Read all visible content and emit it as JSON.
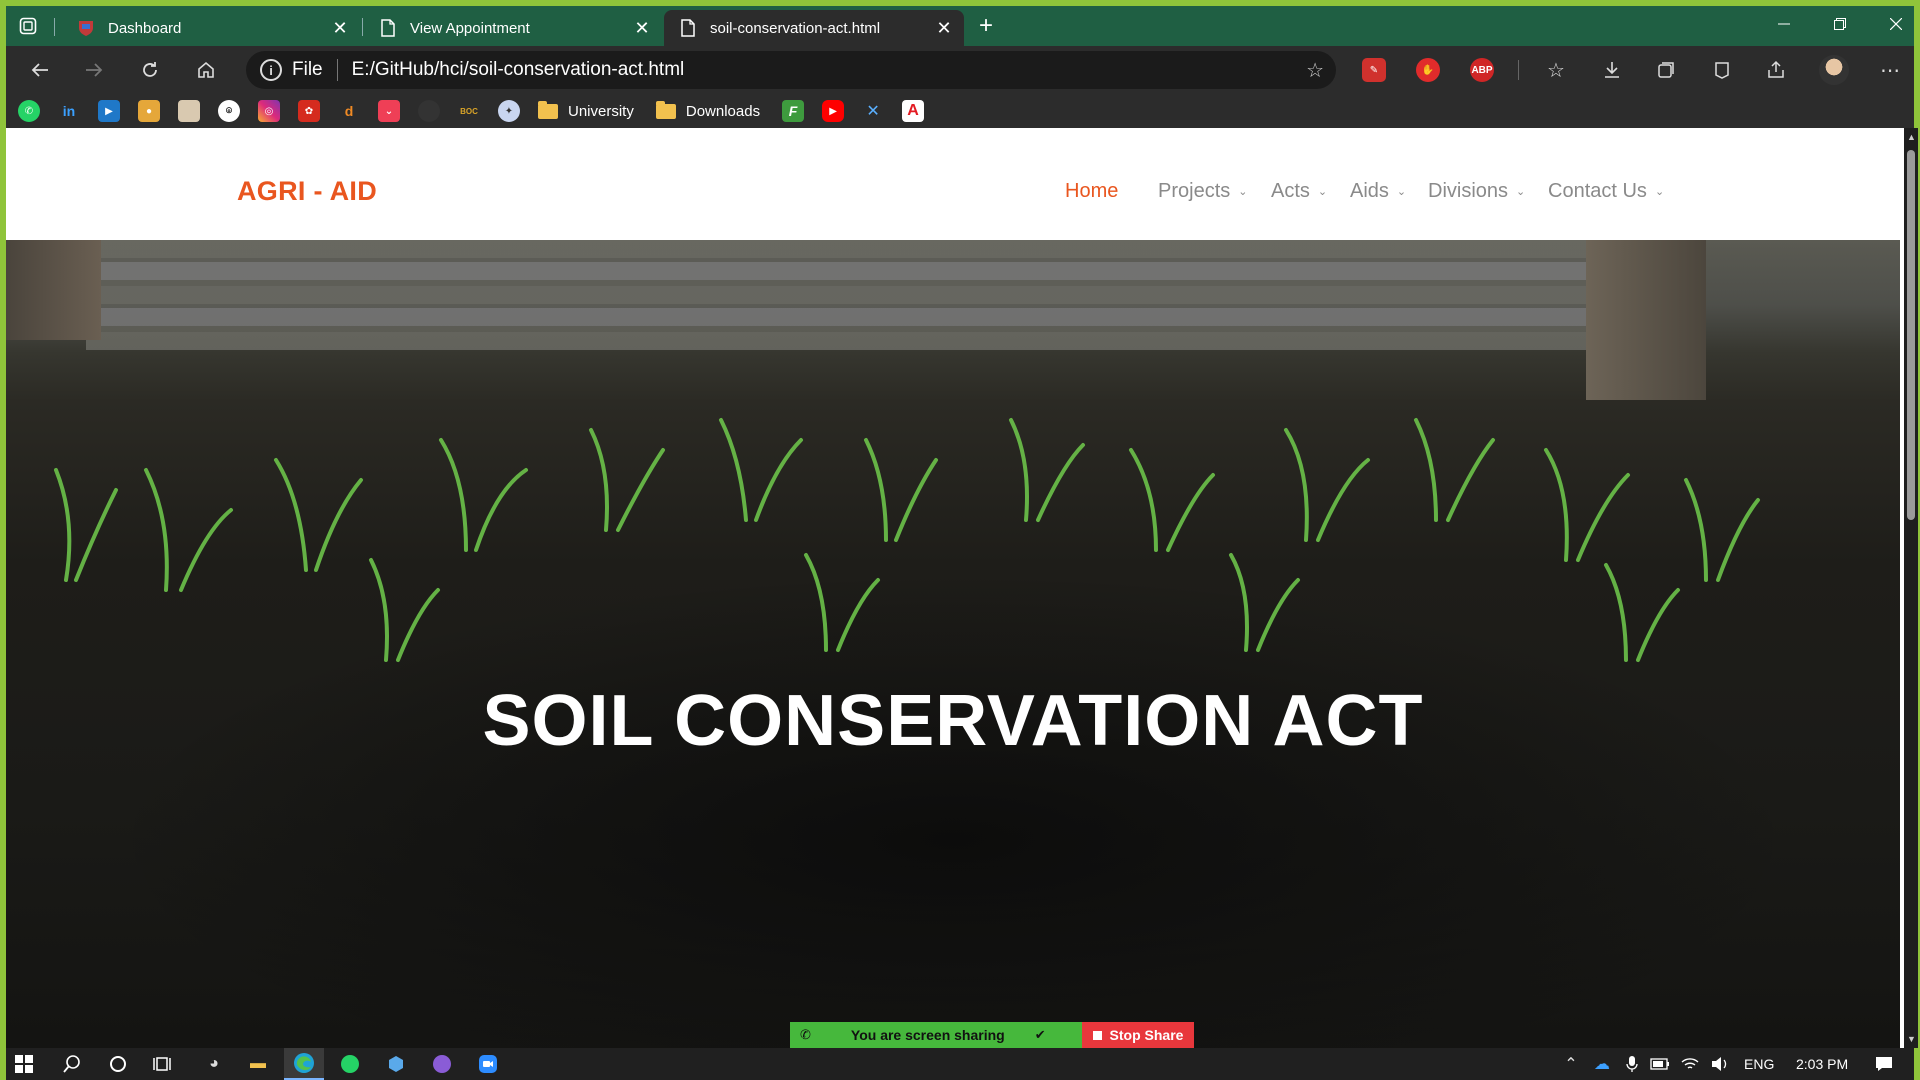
{
  "browser": {
    "tabs": [
      {
        "title": "Dashboard",
        "favicon": "shield-crest-icon",
        "active": false
      },
      {
        "title": "View Appointment",
        "favicon": "document-icon",
        "active": false
      },
      {
        "title": "soil-conservation-act.html",
        "favicon": "document-icon",
        "active": true
      }
    ],
    "close_glyph": "✕",
    "new_tab_glyph": "+",
    "address": {
      "scheme_label": "File",
      "url": "E:/GitHub/hci/soil-conservation-act.html"
    },
    "extensions": [
      "pen-extension-icon",
      "hand-extension-icon",
      "adblock-plus-icon"
    ],
    "extension_labels": {
      "abp": "ABP"
    },
    "bookmarks": {
      "folders": [
        {
          "label": "University"
        },
        {
          "label": "Downloads"
        }
      ],
      "icons": [
        "whatsapp-icon",
        "linkedin-icon",
        "video-icon",
        "cinema-icon",
        "photo-icon",
        "github-icon",
        "instagram-icon",
        "huawei-icon",
        "dx-icon",
        "pocket-icon",
        "circle-icon",
        "boc-icon",
        "emblem-icon",
        "f-icon",
        "youtube-icon",
        "x-icon",
        "adobe-icon"
      ],
      "boc_label": "BOC"
    }
  },
  "page": {
    "logo": "AGRI - AID",
    "nav": [
      {
        "label": "Home",
        "active": true,
        "dropdown": false
      },
      {
        "label": "Projects",
        "active": false,
        "dropdown": true
      },
      {
        "label": "Acts",
        "active": false,
        "dropdown": true
      },
      {
        "label": "Aids",
        "active": false,
        "dropdown": true
      },
      {
        "label": "Divisions",
        "active": false,
        "dropdown": true
      },
      {
        "label": "Contact Us",
        "active": false,
        "dropdown": true
      }
    ],
    "hero_title": "SOIL CONSERVATION ACT",
    "colors": {
      "accent": "#e9561f",
      "nav_text": "#8a8a8a"
    }
  },
  "screen_share": {
    "message": "You are screen sharing",
    "stop_label": "Stop Share"
  },
  "taskbar": {
    "language": "ENG",
    "time": "2:03 PM"
  }
}
